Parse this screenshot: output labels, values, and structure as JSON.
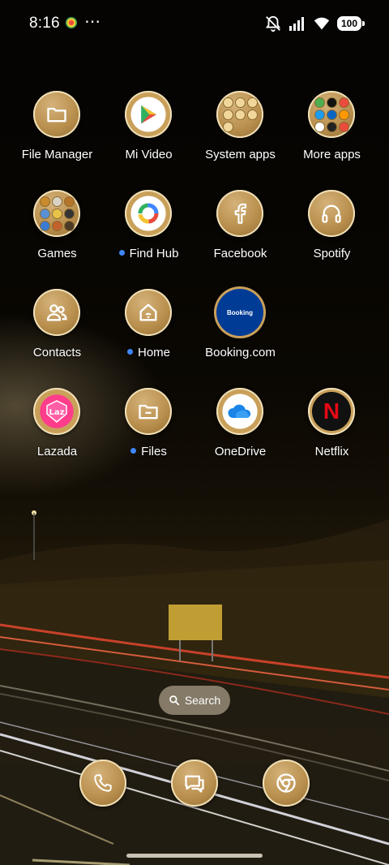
{
  "status_bar": {
    "time": "8:16",
    "overflow_indicator": "⋯",
    "battery_level": "100",
    "icons": [
      "notification-icon",
      "mute-icon",
      "signal-icon",
      "wifi-icon",
      "battery-icon"
    ]
  },
  "apps": [
    {
      "label": "File Manager",
      "icon": "folder-icon",
      "dot": false
    },
    {
      "label": "Mi Video",
      "icon": "play-icon",
      "dot": false
    },
    {
      "label": "System apps",
      "icon": "folder-system-icon",
      "dot": false
    },
    {
      "label": "More apps",
      "icon": "folder-more-icon",
      "dot": false
    },
    {
      "label": "Games",
      "icon": "folder-games-icon",
      "dot": false
    },
    {
      "label": "Find Hub",
      "icon": "google-icon",
      "dot": true
    },
    {
      "label": "Facebook",
      "icon": "facebook-icon",
      "dot": false
    },
    {
      "label": "Spotify",
      "icon": "headphones-icon",
      "dot": false
    },
    {
      "label": "Contacts",
      "icon": "contacts-icon",
      "dot": false
    },
    {
      "label": "Home",
      "icon": "home-icon",
      "dot": true
    },
    {
      "label": "Booking.com",
      "icon": "booking-icon",
      "dot": false,
      "inner_text": "Booking"
    },
    {
      "label": "Lazada",
      "icon": "lazada-icon",
      "dot": false,
      "inner_text": "Laz"
    },
    {
      "label": "Files",
      "icon": "files-icon",
      "dot": true
    },
    {
      "label": "OneDrive",
      "icon": "cloud-icon",
      "dot": false
    },
    {
      "label": "Netflix",
      "icon": "netflix-icon",
      "dot": false,
      "inner_text": "N"
    }
  ],
  "search": {
    "label": "Search",
    "icon": "search-icon"
  },
  "dock": [
    {
      "name": "phone",
      "icon": "phone-icon"
    },
    {
      "name": "messages",
      "icon": "messages-icon"
    },
    {
      "name": "chrome",
      "icon": "chrome-icon"
    }
  ],
  "colors": {
    "icon_gold": "#b98f4d",
    "badge_dot": "#3f86ff",
    "netflix_red": "#e50914",
    "booking_blue": "#003b95"
  }
}
